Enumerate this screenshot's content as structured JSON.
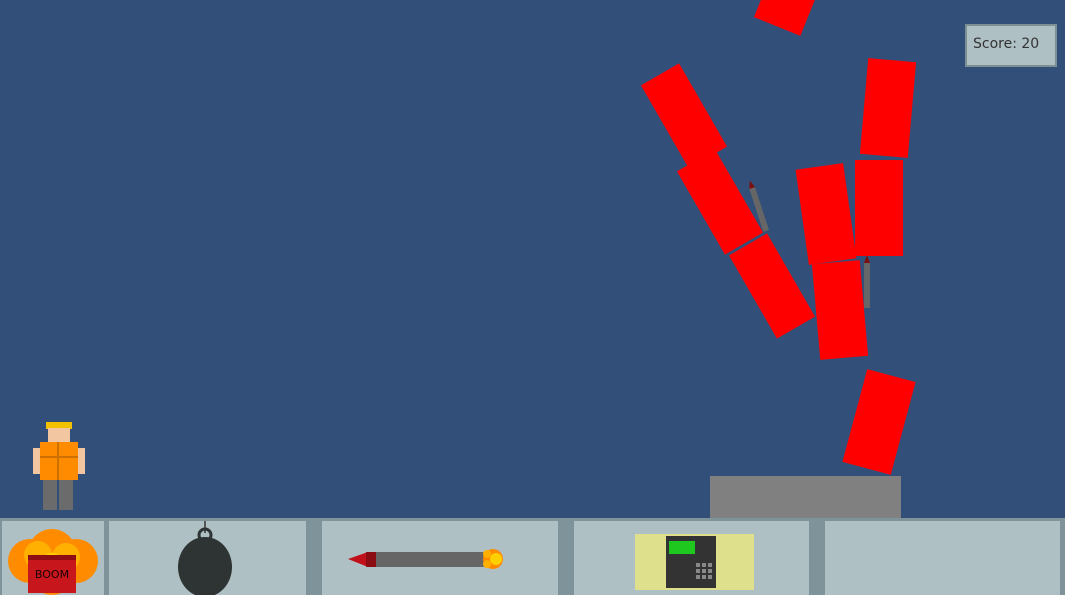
{
  "hud": {
    "score_label": "Score: 20"
  },
  "toolbar": {
    "tools": [
      {
        "name": "dynamite",
        "label": "BOOM"
      },
      {
        "name": "bomb"
      },
      {
        "name": "rocket"
      },
      {
        "name": "remote-detonator"
      },
      {
        "name": "empty"
      }
    ]
  },
  "colors": {
    "sky": "#324f7a",
    "block": "#ff0000",
    "platform": "#808080",
    "toolbar_bg": "#7f939a",
    "slot_bg": "#aec0c4"
  }
}
